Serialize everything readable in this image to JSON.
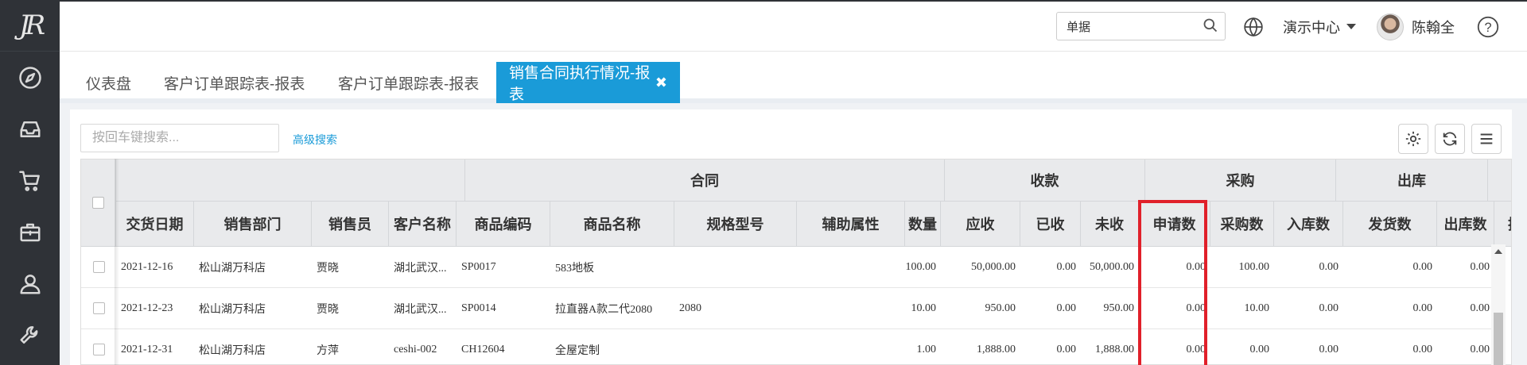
{
  "sidebar": {
    "logo": "JR",
    "icons": [
      "compass-icon",
      "inbox-icon",
      "cart-icon",
      "briefcase-icon",
      "user-icon",
      "wrench-icon"
    ]
  },
  "header": {
    "search_value": "单据",
    "workspace": "演示中心",
    "user_name": "陈翰全",
    "help": "?"
  },
  "tabs": [
    {
      "label": "仪表盘"
    },
    {
      "label": "客户订单跟踪表-报表"
    },
    {
      "label": "客户订单跟踪表-报表"
    },
    {
      "label": "销售合同执行情况-报表",
      "active": true
    }
  ],
  "toolbar": {
    "search_placeholder": "按回车键搜索...",
    "advanced_search": "高级搜索"
  },
  "table": {
    "group_headers": {
      "contract": "合同",
      "payment": "收款",
      "purchase": "采购",
      "outbound": "出库"
    },
    "columns": [
      "交货日期",
      "销售部门",
      "销售员",
      "客户名称",
      "商品编码",
      "商品名称",
      "规格型号",
      "辅助属性",
      "数量",
      "应收",
      "已收",
      "未收",
      "申请数",
      "采购数",
      "入库数",
      "发货数",
      "出库数",
      "换"
    ],
    "rows": [
      [
        "2021-12-16",
        "松山湖万科店",
        "贾晓",
        "湖北武汉...",
        "SP0017",
        "583地板",
        "",
        "",
        "100.00",
        "50,000.00",
        "0.00",
        "50,000.00",
        "0.00",
        "100.00",
        "0.00",
        "0.00",
        "0.00"
      ],
      [
        "2021-12-23",
        "松山湖万科店",
        "贾晓",
        "湖北武汉...",
        "SP0014",
        "拉直器A款二代2080",
        "2080",
        "",
        "10.00",
        "950.00",
        "0.00",
        "950.00",
        "0.00",
        "10.00",
        "0.00",
        "0.00",
        "0.00"
      ],
      [
        "2021-12-31",
        "松山湖万科店",
        "方萍",
        "ceshi-002",
        "CH12604",
        "全屋定制",
        "",
        "",
        "1.00",
        "1,888.00",
        "0.00",
        "1,888.00",
        "0.00",
        "0.00",
        "0.00",
        "0.00",
        "0.00"
      ]
    ]
  },
  "colors": {
    "sidebar": "#2f3237",
    "accent": "#1a9bd8",
    "highlight": "#e0202a"
  }
}
